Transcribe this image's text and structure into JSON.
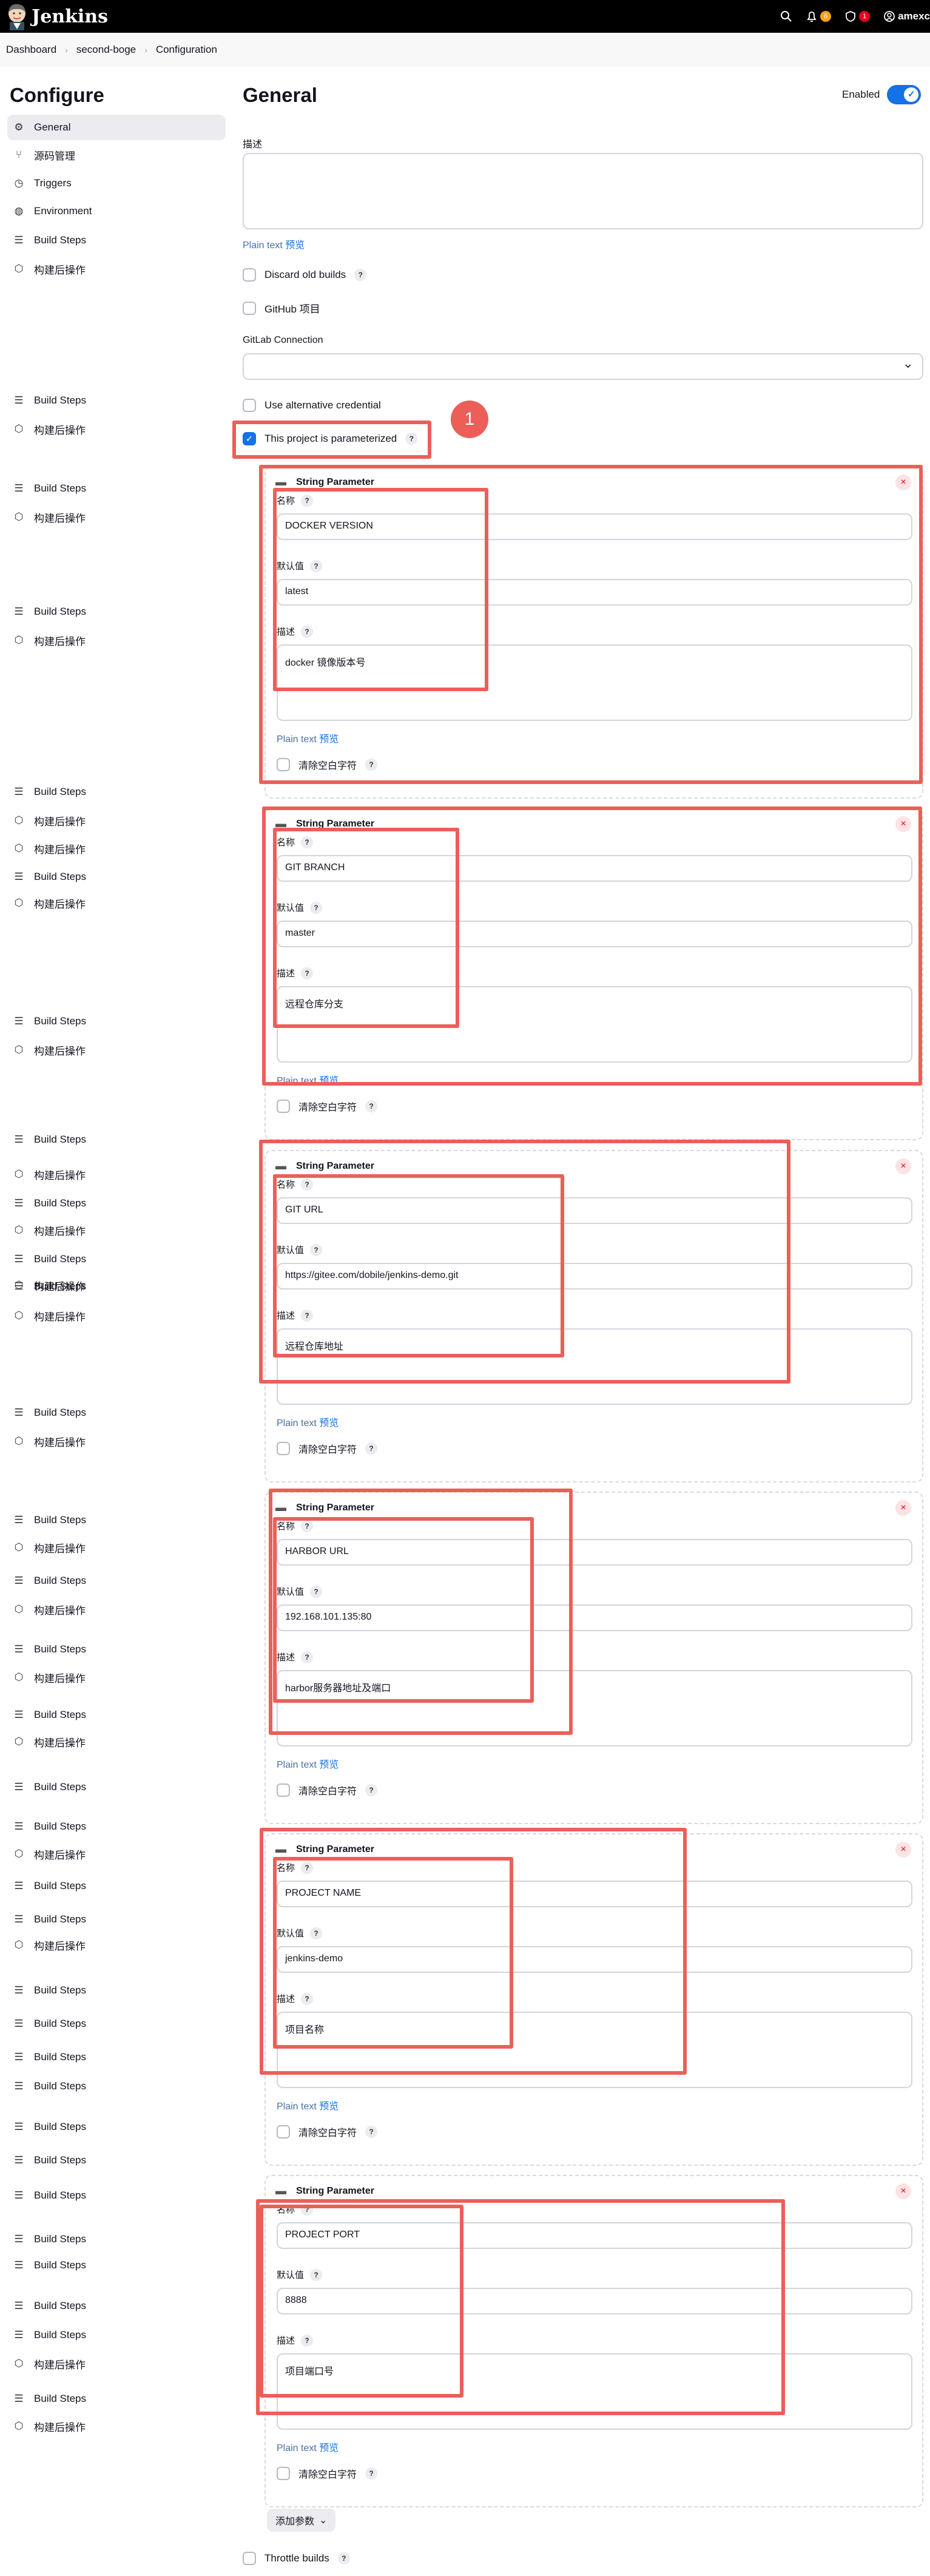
{
  "header": {
    "brand": "Jenkins",
    "notifications_count": "6",
    "security_count": "1",
    "user": "amexc"
  },
  "breadcrumb": [
    "Dashboard",
    "second-boge",
    "Configuration"
  ],
  "sidebar": {
    "title": "Configure",
    "items": [
      {
        "label": "General",
        "icon": "gear-icon"
      },
      {
        "label": "源码管理",
        "icon": "branch-icon"
      },
      {
        "label": "Triggers",
        "icon": "clock-icon"
      },
      {
        "label": "Environment",
        "icon": "globe-icon"
      },
      {
        "label": "Build Steps",
        "icon": "list-icon"
      },
      {
        "label": "构建后操作",
        "icon": "cube-icon"
      }
    ]
  },
  "main": {
    "title": "General",
    "enabled_label": "Enabled",
    "description_label": "描述",
    "plain_text": "Plain text",
    "preview": "预览",
    "discard_old_builds": "Discard old builds",
    "github_project": "GitHub 项目",
    "gitlab_connection_label": "GitLab Connection",
    "use_alt_credential": "Use alternative credential",
    "parameterized": "This project is parameterized",
    "marker": "1",
    "add_param": "添加参数",
    "throttle_builds": "Throttle builds"
  },
  "param_labels": {
    "type": "String Parameter",
    "name": "名称",
    "default": "默认值",
    "desc": "描述",
    "trim": "清除空白字符"
  },
  "params": [
    {
      "name": "DOCKER VERSION",
      "default": "latest",
      "desc": "docker 镜像版本号"
    },
    {
      "name": "GIT BRANCH",
      "default": "master",
      "desc": "远程仓库分支"
    },
    {
      "name": "GIT URL",
      "default": "https://gitee.com/dobile/jenkins-demo.git",
      "desc": "远程仓库地址"
    },
    {
      "name": "HARBOR URL",
      "default": "192.168.101.135:80",
      "desc": "harbor服务器地址及端口"
    },
    {
      "name": "PROJECT NAME",
      "default": "jenkins-demo",
      "desc": "项目名称"
    },
    {
      "name": "PROJECT PORT",
      "default": "8888",
      "desc": "项目端口号"
    }
  ],
  "colors": {
    "accent": "#1471e6",
    "annotation": "#ec5f59"
  }
}
